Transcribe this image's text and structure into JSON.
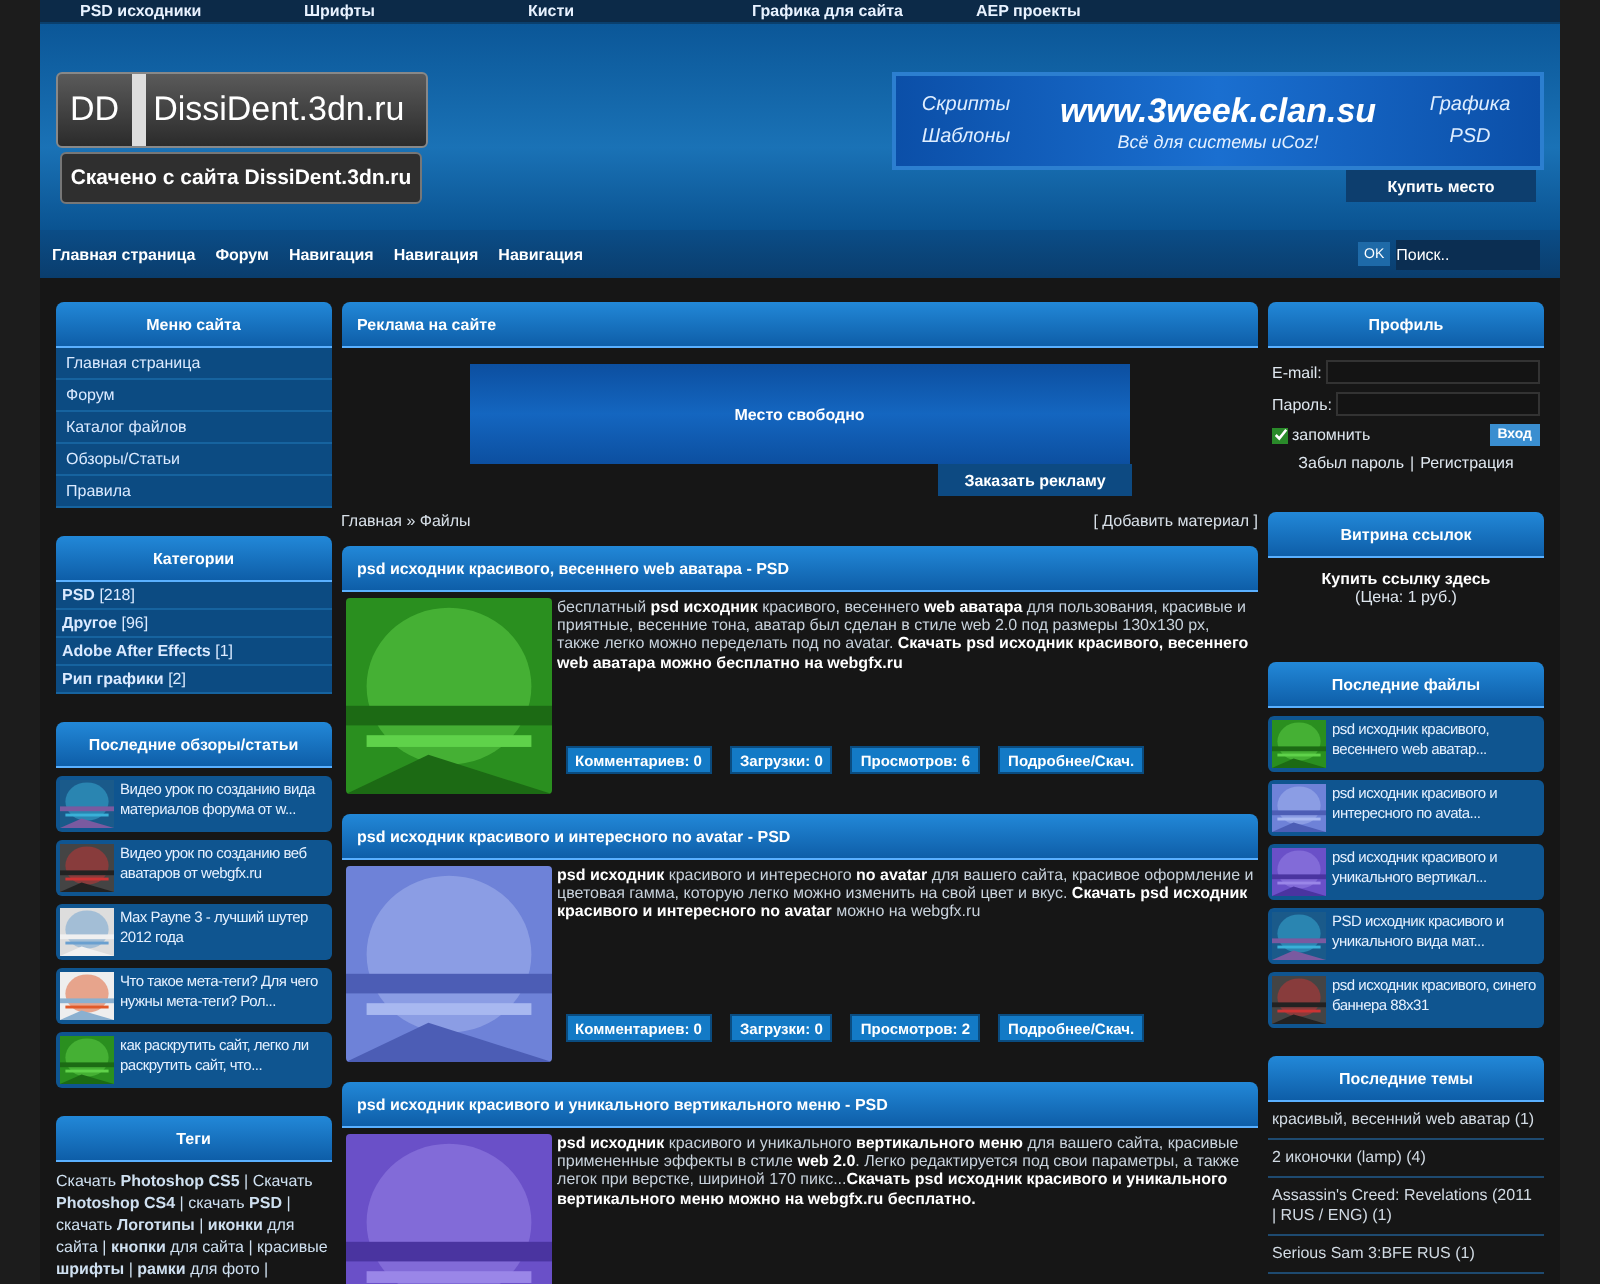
{
  "top_menu": [
    "PSD исходники",
    "Шрифты",
    "Кисти",
    "Графика для сайта",
    "AEP проекты"
  ],
  "logo": {
    "mark": "DD",
    "title": "DissiDent.3dn.ru",
    "subtitle": "Скачено с сайта DissiDent.3dn.ru"
  },
  "banner": {
    "left": [
      "Скрипты",
      "Шаблоны"
    ],
    "url": "www.3week.clan.su",
    "tagline": "Всё для системы uCoz!",
    "right": [
      "Графика",
      "PSD"
    ],
    "button": "Купить место"
  },
  "nav": [
    "Главная страница",
    "Форум",
    "Навигация",
    "Навигация",
    "Навигация"
  ],
  "search": {
    "button": "OK",
    "placeholder": "Поиск.."
  },
  "left": {
    "menu": {
      "title": "Меню сайта",
      "items": [
        "Главная страница",
        "Форум",
        "Каталог файлов",
        "Обзоры/Статьи",
        "Правила"
      ]
    },
    "categories": {
      "title": "Категории",
      "items": [
        {
          "name": "PSD",
          "count": "[218]"
        },
        {
          "name": "Другое",
          "count": "[96]"
        },
        {
          "name": "Adobe After Effects",
          "count": "[1]"
        },
        {
          "name": "Рип графики",
          "count": "[2]"
        }
      ]
    },
    "reviews": {
      "title": "Последние обзоры/статьи",
      "items": [
        "Видео урок по созданию вида материалов форума от w...",
        "Видео урок по созданию веб аватаров от webgfx.ru",
        "Max Payne 3 - лучший шутер 2012 года",
        "Что такое мета-теги? Для чего нужны мета-теги? Рол...",
        "как раскрутить сайт, легко ли раскрутить сайт, что..."
      ]
    },
    "tags": {
      "title": "Теги",
      "text": "Скачать **Photoshop CS5** | Скачать **Photoshop CS4** | скачать **PSD** | скачать **Логотипы** | **иконки** для сайта | **кнопки** для сайта | красивые **шрифты** | **рамки** для фото |"
    }
  },
  "ad": {
    "title": "Реклама на сайте",
    "text": "Место свободно",
    "button": "Заказать рекламу"
  },
  "breadcrumb": "Главная » Файлы",
  "add_link": "[ Добавить материал ]",
  "entries": [
    {
      "title": "psd исходник красивого, весеннего web аватара - PSD",
      "text": "бесплатный **psd исходник** красивого, весеннего **web аватара** для пользования, красивые и приятные, весенние тона, аватар был сделан в стиле web 2.0 под размеры 130х130 px, также легко можно переделать под no avatar. **Скачать psd исходник красивого, весеннего web аватара можно бесплатно на webgfx.ru**",
      "stats": [
        "Комментариев: 0",
        "Загрузки: 0",
        "Просмотров: 6",
        "Подробнее/Скач."
      ]
    },
    {
      "title": "psd исходник красивого и интересного no avatar - PSD",
      "text": "**psd исходник** красивого и интересного **no avatar** для вашего сайта, красивое оформление и цветовая гамма, которую легко можно изменить на свой цвет и вкус. **Скачать psd исходник красивого и интересного no avatar** можно на webgfx.ru",
      "stats": [
        "Комментариев: 0",
        "Загрузки: 0",
        "Просмотров: 2",
        "Подробнее/Скач."
      ]
    },
    {
      "title": "psd исходник красивого и уникального вертикального меню - PSD",
      "text": "**psd исходник** красивого и уникального **вертикального меню** для вашего сайта, красивые примененные эффекты в стиле **web 2.0**. Легко редактируется под свои параметры, а также легок при верстке, шириной 170 пикс...**Скачать psd исходник красивого и уникального вертикального меню можно на webgfx.ru бесплатно.**"
    }
  ],
  "profile": {
    "title": "Профиль",
    "email_label": "E-mail:",
    "password_label": "Пароль:",
    "remember": {
      "label": "запомнить",
      "checked": true
    },
    "login": "Вход",
    "forgot": "Забыл пароль",
    "separator": "|",
    "register": "Регистрация"
  },
  "showcase": {
    "title": "Витрина ссылок",
    "buy": "Купить ссылку здесь",
    "price": "(Цена: 1 руб.)"
  },
  "files": {
    "title": "Последние файлы",
    "items": [
      "psd исходник красивого, весеннего web аватар...",
      "psd исходник красивого и интересного по avata...",
      "psd исходник красивого и уникального вертикал...",
      "PSD исходник красивого и уникального вида мат...",
      "psd исходник красивого, синего баннера 88х31"
    ]
  },
  "topics": {
    "title": "Последние темы",
    "items": [
      "красивый, весенний web аватар (1)",
      "2 иконочки (lamp) (4)",
      "Assassin's Creed: Revelations (2011 | RUS / ENG) (1)",
      "Serious Sam 3:BFE RUS (1)"
    ]
  }
}
